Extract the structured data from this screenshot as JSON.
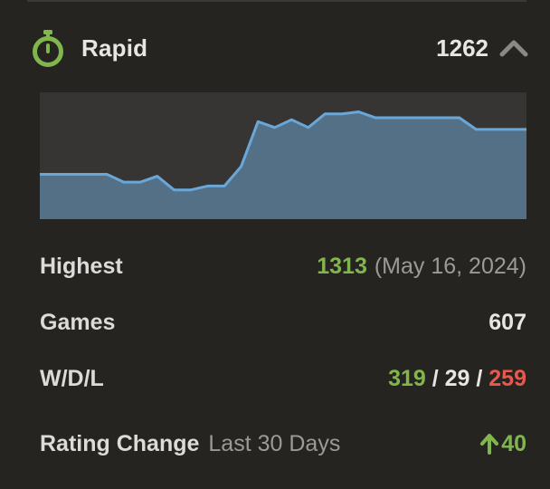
{
  "mode": {
    "label": "Rapid",
    "rating": "1262",
    "icon": "stopwatch-icon",
    "expand_icon": "chevron-up-icon"
  },
  "colors": {
    "accent_green": "#81b64c",
    "loss_red": "#e8584d",
    "chart_fill": "#537086",
    "chart_line": "#6aa7d9"
  },
  "chart_data": {
    "type": "area",
    "values": [
      1278,
      1278,
      1278,
      1278,
      1278,
      1274,
      1274,
      1277,
      1270,
      1270,
      1272,
      1272,
      1282,
      1305,
      1302,
      1306,
      1302,
      1309,
      1309,
      1310,
      1307,
      1307,
      1307,
      1307,
      1307,
      1307,
      1301,
      1301,
      1301,
      1301
    ],
    "ylim": [
      1255,
      1320
    ],
    "grid": false,
    "legend": "none"
  },
  "stats": {
    "highest": {
      "label": "Highest",
      "value": "1313",
      "date": "(May 16, 2024)"
    },
    "games": {
      "label": "Games",
      "value": "607"
    },
    "wdl": {
      "label": "W/D/L",
      "wins": "319",
      "sep1": " / ",
      "draws": "29",
      "sep2": " / ",
      "losses": "259"
    },
    "rating_change": {
      "label": "Rating Change",
      "period": "Last 30 Days",
      "value": "40",
      "icon": "arrow-up-icon"
    }
  }
}
